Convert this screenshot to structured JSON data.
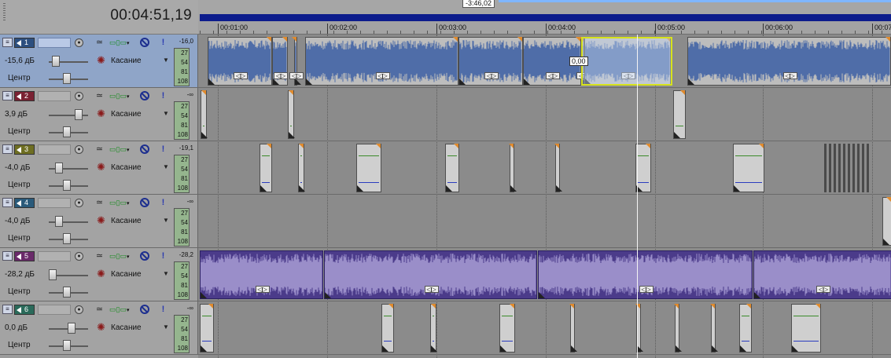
{
  "header": {
    "timecode": "00:04:51,19"
  },
  "ruler": {
    "marker_label": "-3:46,02",
    "labels": [
      {
        "text": "00:01:00"
      },
      {
        "text": "00:02:00"
      },
      {
        "text": "00:03:00"
      },
      {
        "text": "00:04:00"
      },
      {
        "text": "00:05:00"
      },
      {
        "text": "00:06:00"
      },
      {
        "text": "00:07"
      }
    ]
  },
  "cursor": {
    "label": "0,00"
  },
  "tracks": [
    {
      "number": "1",
      "color": "#2d4f7f",
      "selected": true,
      "volume": "-15,6 дБ",
      "pan": "Центр",
      "touch": "Касание",
      "peak": "-16,0",
      "meter": [
        "27",
        "54",
        "81",
        "108"
      ]
    },
    {
      "number": "2",
      "color": "#7a2233",
      "selected": false,
      "volume": "3,9 дБ",
      "pan": "Центр",
      "touch": "Касание",
      "peak": "-∞",
      "meter": [
        "27",
        "54",
        "81",
        "108"
      ]
    },
    {
      "number": "3",
      "color": "#6e6e22",
      "selected": false,
      "volume": "-4,0 дБ",
      "pan": "Центр",
      "touch": "Касание",
      "peak": "-19,1",
      "meter": [
        "27",
        "54",
        "81",
        "108"
      ]
    },
    {
      "number": "4",
      "color": "#2a5a7a",
      "selected": false,
      "volume": "-4,0 дБ",
      "pan": "Центр",
      "touch": "Касание",
      "peak": "-∞",
      "meter": [
        "27",
        "54",
        "81",
        "108"
      ]
    },
    {
      "number": "5",
      "color": "#6a2a6a",
      "selected": false,
      "volume": "-28,2 дБ",
      "pan": "Центр",
      "touch": "Касание",
      "peak": "-28,2",
      "meter": [
        "27",
        "54",
        "81",
        "108"
      ]
    },
    {
      "number": "6",
      "color": "#2a6a5a",
      "selected": false,
      "volume": "0,0 дБ",
      "pan": "Центр",
      "touch": "Касание",
      "peak": "-∞",
      "meter": [
        "27",
        "54",
        "81",
        "108"
      ]
    }
  ],
  "icons": {
    "minimize": "minimize-icon",
    "speaker": "speaker-icon",
    "record": "record-arm-icon",
    "envelope": "envelope-icon",
    "fx": "fx-chain-icon",
    "mute": "mute-icon",
    "solo": "solo-icon",
    "touch": "automation-touch-icon"
  }
}
